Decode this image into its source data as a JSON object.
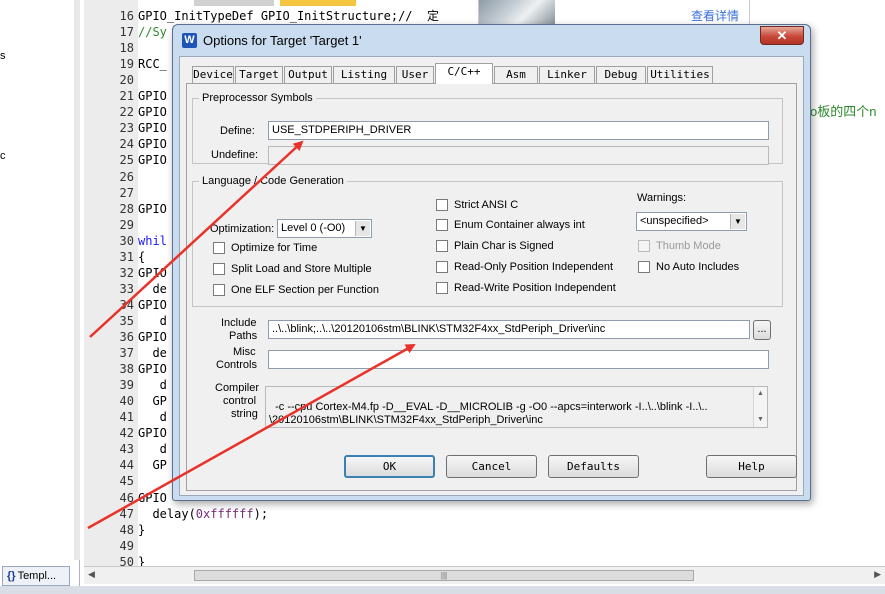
{
  "editor": {
    "lines": [
      {
        "n": "16",
        "parts": [
          {
            "t": "GPIO_InitTypeDef GPIO_InitStructure;//  定"
          }
        ]
      },
      {
        "n": "17",
        "parts": [
          {
            "t": "//Sy",
            "c": "cm"
          }
        ]
      },
      {
        "n": "18",
        "parts": [
          {
            "t": ""
          }
        ]
      },
      {
        "n": "19",
        "parts": [
          {
            "t": "RCC_"
          }
        ]
      },
      {
        "n": "20",
        "parts": [
          {
            "t": ""
          }
        ]
      },
      {
        "n": "21",
        "parts": [
          {
            "t": "GPIO"
          }
        ]
      },
      {
        "n": "22",
        "parts": [
          {
            "t": "GPIO"
          }
        ]
      },
      {
        "n": "23",
        "parts": [
          {
            "t": "GPIO"
          }
        ]
      },
      {
        "n": "24",
        "parts": [
          {
            "t": "GPIO"
          }
        ]
      },
      {
        "n": "25",
        "parts": [
          {
            "t": "GPIO"
          }
        ]
      },
      {
        "n": "26",
        "parts": [
          {
            "t": ""
          }
        ]
      },
      {
        "n": "27",
        "parts": [
          {
            "t": ""
          }
        ]
      },
      {
        "n": "28",
        "parts": [
          {
            "t": "GPIO"
          }
        ]
      },
      {
        "n": "29",
        "parts": [
          {
            "t": ""
          }
        ]
      },
      {
        "n": "30",
        "parts": [
          {
            "t": "whil",
            "c": "kw"
          }
        ]
      },
      {
        "n": "31",
        "parts": [
          {
            "t": "{"
          }
        ]
      },
      {
        "n": "32",
        "parts": [
          {
            "t": "GPIO"
          }
        ]
      },
      {
        "n": "33",
        "parts": [
          {
            "t": "  de"
          }
        ]
      },
      {
        "n": "34",
        "parts": [
          {
            "t": "GPIO"
          }
        ]
      },
      {
        "n": "35",
        "parts": [
          {
            "t": "   d"
          }
        ]
      },
      {
        "n": "36",
        "parts": [
          {
            "t": "GPIO"
          }
        ]
      },
      {
        "n": "37",
        "parts": [
          {
            "t": "  de"
          }
        ]
      },
      {
        "n": "38",
        "parts": [
          {
            "t": "GPIO"
          }
        ]
      },
      {
        "n": "39",
        "parts": [
          {
            "t": "   d"
          }
        ]
      },
      {
        "n": "40",
        "parts": [
          {
            "t": "  GP"
          }
        ]
      },
      {
        "n": "41",
        "parts": [
          {
            "t": "   d"
          }
        ]
      },
      {
        "n": "42",
        "parts": [
          {
            "t": "GPIO"
          }
        ]
      },
      {
        "n": "43",
        "parts": [
          {
            "t": "   d"
          }
        ]
      },
      {
        "n": "44",
        "parts": [
          {
            "t": "  GP"
          }
        ]
      },
      {
        "n": "45",
        "parts": [
          {
            "t": ""
          }
        ]
      },
      {
        "n": "46",
        "parts": [
          {
            "t": "GPIO"
          }
        ]
      },
      {
        "n": "47",
        "parts": [
          {
            "t": "  delay("
          },
          {
            "t": "0xffffff",
            "c": "num"
          },
          {
            "t": ");"
          }
        ]
      },
      {
        "n": "48",
        "parts": [
          {
            "t": "}"
          }
        ]
      },
      {
        "n": "49",
        "parts": [
          {
            "t": ""
          }
        ]
      },
      {
        "n": "50",
        "parts": [
          {
            "t": "}"
          }
        ]
      }
    ],
    "side_comment": "o板的四个n"
  },
  "left_panel": {
    "fragments": [
      "s",
      "c"
    ],
    "tab_icon": "{}",
    "tab_label": "Templ..."
  },
  "notification": {
    "link_text": "查看详情"
  },
  "dialog": {
    "title": "Options for Target 'Target 1'",
    "close_label": "✕",
    "icon_letter": "W",
    "tabs": [
      "Device",
      "Target",
      "Output",
      "Listing",
      "User",
      "C/C++",
      "Asm",
      "Linker",
      "Debug",
      "Utilities"
    ],
    "active_tab": "C/C++",
    "preprocessor": {
      "legend": "Preprocessor Symbols",
      "define_label": "Define:",
      "define_value": "USE_STDPERIPH_DRIVER",
      "undefine_label": "Undefine:",
      "undefine_value": ""
    },
    "language": {
      "legend": "Language / Code Generation",
      "optimization_label": "Optimization:",
      "optimization_value": "Level 0 (-O0)",
      "warnings_label": "Warnings:",
      "warnings_value": "<unspecified>",
      "checkboxes_left": [
        "Optimize for Time",
        "Split Load and Store Multiple",
        "One ELF Section per Function"
      ],
      "checkboxes_mid": [
        "Strict ANSI C",
        "Enum Container always int",
        "Plain Char is Signed",
        "Read-Only Position Independent",
        "Read-Write Position Independent"
      ],
      "thumb_mode_label": "Thumb Mode",
      "no_auto_includes_label": "No Auto Includes"
    },
    "include_paths_label_1": "Include",
    "include_paths_label_2": "Paths",
    "include_paths_value": "..\\..\\blink;..\\..\\20120106stm\\BLINK\\STM32F4xx_StdPeriph_Driver\\inc",
    "browse_label": "...",
    "misc_label_1": "Misc",
    "misc_label_2": "Controls",
    "misc_value": "",
    "compiler_label_1": "Compiler",
    "compiler_label_2": "control",
    "compiler_label_3": "string",
    "compiler_string": "-c --cpu Cortex-M4.fp -D__EVAL -D__MICROLIB -g -O0 --apcs=interwork -I..\\..\\blink -I..\\..\n\\20120106stm\\BLINK\\STM32F4xx_StdPeriph_Driver\\inc",
    "buttons": {
      "ok": "OK",
      "cancel": "Cancel",
      "defaults": "Defaults",
      "help": "Help"
    }
  },
  "colors": {
    "arrow": "#e8322a",
    "dialog_frame": "#c9dcf0",
    "keyword": "#1a1aff",
    "comment": "#2d8a2d"
  }
}
